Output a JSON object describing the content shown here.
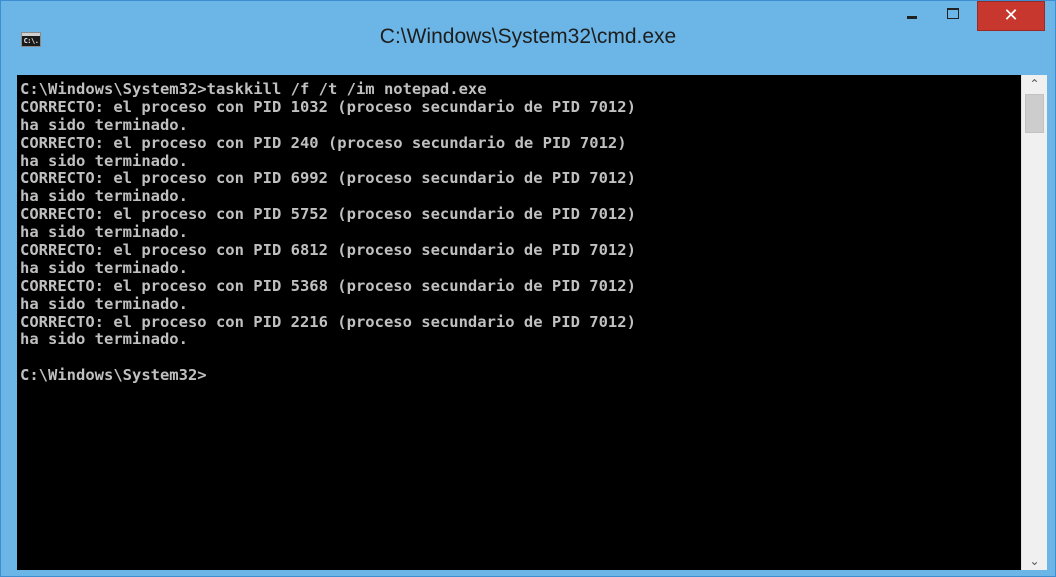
{
  "window": {
    "title": "C:\\Windows\\System32\\cmd.exe",
    "icon_label": "C:\\.",
    "icon_name": "cmd-icon"
  },
  "controls": {
    "minimize": "minimize-icon",
    "maximize": "maximize-icon",
    "close": "close-icon",
    "close_glyph": "✕",
    "close_color": "#c8372d"
  },
  "colors": {
    "frame": "#6bb6e6",
    "console_background": "#000000",
    "console_text": "#c0c0c0"
  },
  "console": {
    "lines": [
      "C:\\Windows\\System32>taskkill /f /t /im notepad.exe",
      "CORRECTO: el proceso con PID 1032 (proceso secundario de PID 7012)",
      "ha sido terminado.",
      "CORRECTO: el proceso con PID 240 (proceso secundario de PID 7012)",
      "ha sido terminado.",
      "CORRECTO: el proceso con PID 6992 (proceso secundario de PID 7012)",
      "ha sido terminado.",
      "CORRECTO: el proceso con PID 5752 (proceso secundario de PID 7012)",
      "ha sido terminado.",
      "CORRECTO: el proceso con PID 6812 (proceso secundario de PID 7012)",
      "ha sido terminado.",
      "CORRECTO: el proceso con PID 5368 (proceso secundario de PID 7012)",
      "ha sido terminado.",
      "CORRECTO: el proceso con PID 2216 (proceso secundario de PID 7012)",
      "ha sido terminado.",
      "",
      "C:\\Windows\\System32>"
    ]
  },
  "scrollbar": {
    "up_glyph": "⌃",
    "down_glyph": "⌄",
    "up_icon": "chevron-up-icon",
    "down_icon": "chevron-down-icon"
  }
}
